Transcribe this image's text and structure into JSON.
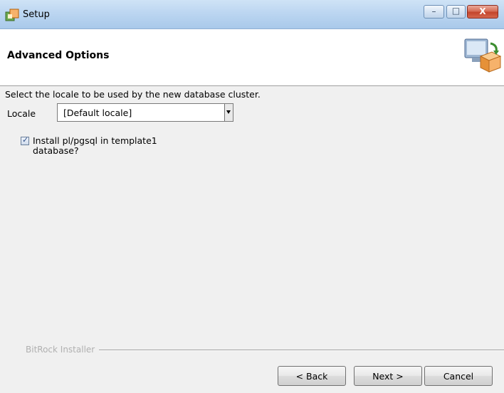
{
  "window": {
    "title": "Setup",
    "controls": {
      "minimize": "–",
      "maximize": "□",
      "close": "X"
    }
  },
  "header": {
    "title": "Advanced Options",
    "icon": "installer-package-icon"
  },
  "main": {
    "prompt": "Select the locale to be used by the new database cluster.",
    "locale": {
      "label": "Locale",
      "value": "[Default locale]"
    },
    "install_plpgsql": {
      "label": "Install pl/pgsql in template1 database?",
      "checked": true
    }
  },
  "footer": {
    "brand": "BitRock Installer",
    "back_label": "< Back",
    "next_label": "Next >",
    "cancel_label": "Cancel"
  },
  "colors": {
    "titlebar": "#bcd6f1",
    "close_button": "#c3452c",
    "dialog_bg": "#f0f0f0"
  }
}
